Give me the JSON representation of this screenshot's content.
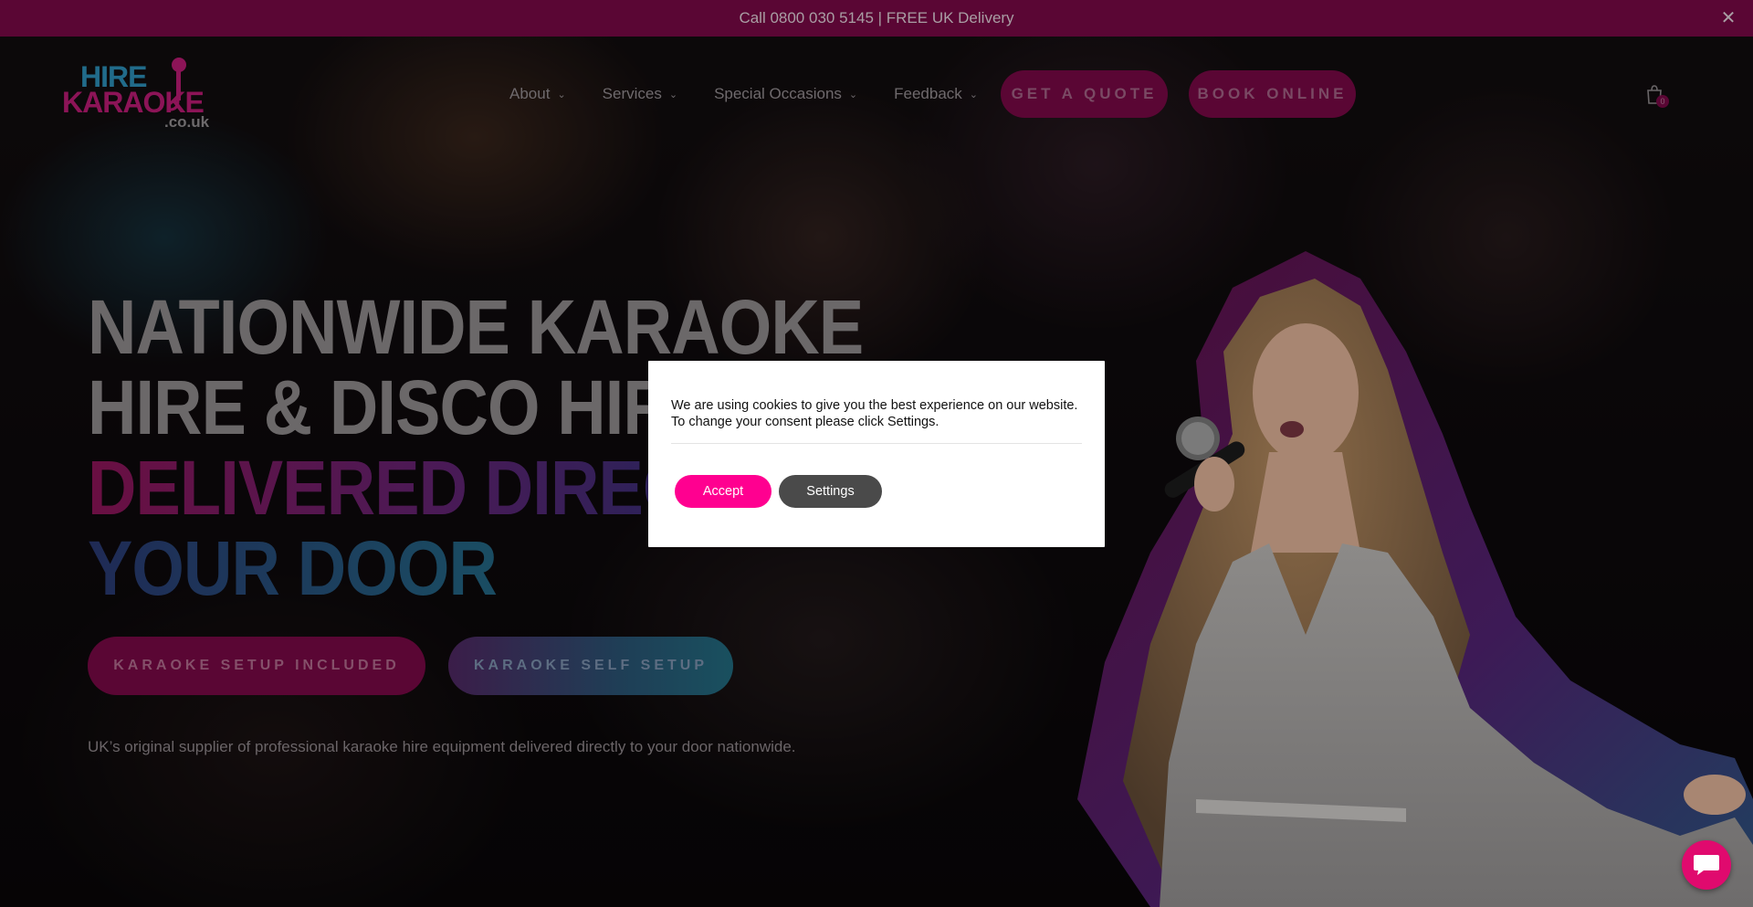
{
  "top_bar": {
    "text": "Call 0800 030 5145 | FREE UK Delivery",
    "close_icon": "close-icon"
  },
  "logo": {
    "line1": "HIRE",
    "line2": "KARAOKE",
    "line3": ".co.uk",
    "icon": "microphone-icon"
  },
  "nav": {
    "items": [
      {
        "label": "About"
      },
      {
        "label": "Services"
      },
      {
        "label": "Special Occasions"
      },
      {
        "label": "Feedback"
      }
    ],
    "chevron_icon": "chevron-down-icon",
    "quote_button": "GET A QUOTE",
    "book_button": "BOOK ONLINE",
    "cart_icon": "shopping-bag-icon",
    "cart_count": "0"
  },
  "hero": {
    "heading_line1": "NATIONWIDE KARAOKE",
    "heading_line2": "HIRE & DISCO HIRE",
    "heading_line3": "DELIVERED DIRECTLY TO",
    "heading_line4": "YOUR DOOR",
    "button_setup_included": "KARAOKE SETUP INCLUDED",
    "button_self_setup": "KARAOKE SELF SETUP",
    "tagline": "UK’s original supplier of professional karaoke hire equipment delivered directly to your door nationwide."
  },
  "cookie": {
    "message": "We are using cookies to give you the best experience on our website. To change your consent please click Settings.",
    "accept_label": "Accept",
    "settings_label": "Settings"
  },
  "chat": {
    "icon": "chat-bubble-icon"
  },
  "colors": {
    "brand_magenta": "#ff0090",
    "brand_dark_magenta": "#5a0634",
    "brand_teal": "#216b8a",
    "settings_gray": "#4a4a4a"
  }
}
